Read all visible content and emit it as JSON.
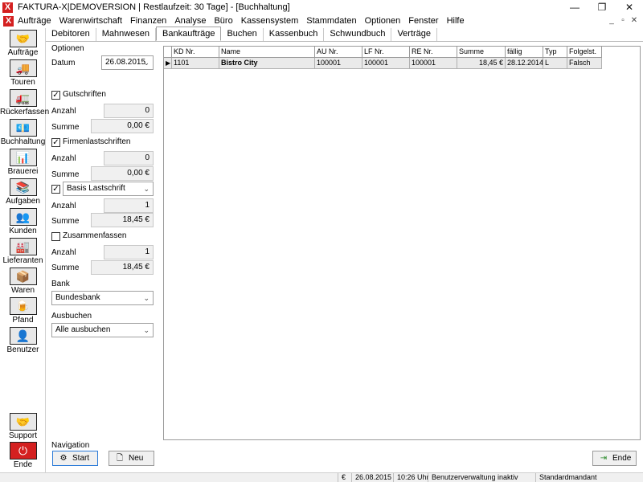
{
  "window": {
    "title": "FAKTURA-X|DEMOVERSION | Restlaufzeit: 30 Tage] - [Buchhaltung]",
    "app_icon": "X",
    "controls": [
      "—",
      "❐",
      "✕"
    ],
    "mdi_controls": [
      "_",
      "▫",
      "✕"
    ]
  },
  "menu": [
    "Aufträge",
    "Warenwirtschaft",
    "Finanzen",
    "Analyse",
    "Büro",
    "Kassensystem",
    "Stammdaten",
    "Optionen",
    "Fenster",
    "Hilfe"
  ],
  "leftnav": [
    {
      "label": "Aufträge",
      "icon": "handshake-icon",
      "glyph": "🤝"
    },
    {
      "label": "Touren",
      "icon": "truck-icon",
      "glyph": "🚚"
    },
    {
      "label": "Rückerfassen",
      "icon": "truck-return-icon",
      "glyph": "🚛"
    },
    {
      "label": "Buchhaltung",
      "icon": "money-icon",
      "glyph": "💶"
    },
    {
      "label": "Brauerei",
      "icon": "chart-icon",
      "glyph": "📊"
    },
    {
      "label": "Aufgaben",
      "icon": "tasks-icon",
      "glyph": "📚"
    },
    {
      "label": "Kunden",
      "icon": "customers-icon",
      "glyph": "👥"
    },
    {
      "label": "Lieferanten",
      "icon": "suppliers-icon",
      "glyph": "🏭"
    },
    {
      "label": "Waren",
      "icon": "goods-icon",
      "glyph": "📦"
    },
    {
      "label": "Pfand",
      "icon": "crates-icon",
      "glyph": "🍺"
    },
    {
      "label": "Benutzer",
      "icon": "user-icon",
      "glyph": "👤"
    },
    {
      "label": "Support",
      "icon": "support-icon",
      "glyph": "🤝"
    },
    {
      "label": "Ende",
      "icon": "power-icon",
      "glyph": "⏻"
    }
  ],
  "tabs": [
    "Debitoren",
    "Mahnwesen",
    "Bankaufträge",
    "Buchen",
    "Kassenbuch",
    "Schwundbuch",
    "Verträge"
  ],
  "active_tab": "Bankaufträge",
  "options": {
    "group_label": "Optionen",
    "datum_label": "Datum",
    "datum_value": "26.08.2015",
    "gutschriften_label": "Gutschriften",
    "gutschriften_anzahl_label": "Anzahl",
    "gutschriften_anzahl": "0",
    "gutschriften_summe_label": "Summe",
    "gutschriften_summe": "0,00 €",
    "firmen_label": "Firmenlastschriften",
    "firmen_anzahl_label": "Anzahl",
    "firmen_anzahl": "0",
    "firmen_summe_label": "Summe",
    "firmen_summe": "0,00 €",
    "basis_value": "Basis Lastschrift",
    "basis_anzahl_label": "Anzahl",
    "basis_anzahl": "1",
    "basis_summe_label": "Summe",
    "basis_summe": "18,45 €",
    "zusammen_label": "Zusammenfassen",
    "zusammen_anzahl_label": "Anzahl",
    "zusammen_anzahl": "1",
    "zusammen_summe_label": "Summe",
    "zusammen_summe": "18,45 €",
    "bank_label": "Bank",
    "bank_value": "Bundesbank",
    "ausbuchen_label": "Ausbuchen",
    "ausbuchen_value": "Alle ausbuchen"
  },
  "grid": {
    "columns": [
      "",
      "KD Nr.",
      "Name",
      "AU Nr.",
      "LF Nr.",
      "RE Nr.",
      "Summe",
      "fällig",
      "Typ",
      "Folgelst."
    ],
    "rows": [
      {
        "marker": "▶",
        "kd": "1101",
        "name": "Bistro City",
        "au": "100001",
        "lf": "100001",
        "re": "100001",
        "summe": "18,45 €",
        "faellig": "28.12.2014",
        "typ": "L",
        "folge": "Falsch"
      }
    ]
  },
  "navigation": {
    "label": "Navigation",
    "start_label": "Start",
    "neu_label": "Neu",
    "ende_label": "Ende"
  },
  "status": {
    "currency": "€",
    "date": "26.08.2015",
    "time": "10:26 Uhr",
    "user_info": "Benutzerverwaltung inaktiv",
    "mandant": "Standardmandant"
  }
}
